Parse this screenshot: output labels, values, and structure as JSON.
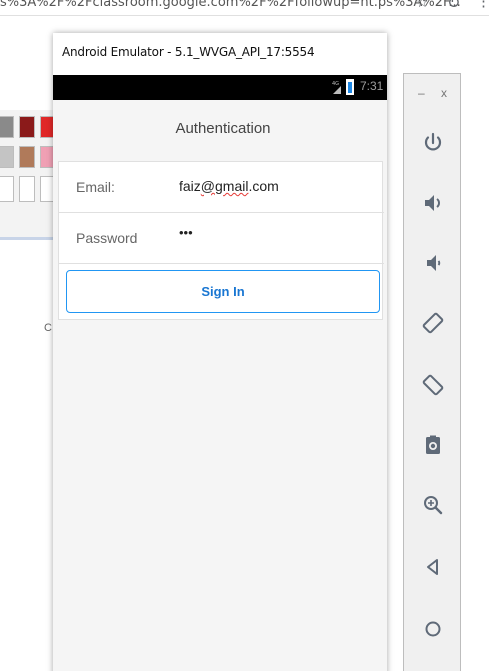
{
  "browser": {
    "url_fragment": "s%3A%2F%2Fclassroom.google.com%2F%2Ffollowup=ht.ps%3A%2F...",
    "star_icon": "star-icon",
    "reload_icon": "reload-icon",
    "more_icon": "more-icon"
  },
  "background_app": {
    "letter": "C",
    "swatches": [
      "#8a8a8a",
      "#8b1a1a",
      "#e02828",
      "#c4c4c4",
      "#b07a5a",
      "#f0a0b4",
      "#ffffff",
      "#ffffff",
      "#ffffff"
    ]
  },
  "emulator": {
    "title": "Android Emulator - 5.1_WVGA_API_17:5554",
    "status_time": "7:31",
    "toolbar": {
      "minimize": "–",
      "close": "x",
      "buttons": [
        "power-icon",
        "volume-up-icon",
        "volume-down-icon",
        "rotate-left-icon",
        "rotate-right-icon",
        "camera-icon",
        "zoom-icon",
        "back-icon",
        "home-icon"
      ]
    }
  },
  "app": {
    "nav_title": "Authentication",
    "email_label": "Email:",
    "email_value_prefix": "faiz",
    "email_value_misspelled": "@gmail",
    "email_value_suffix": ".com",
    "password_label": "Password",
    "password_value": "•••",
    "signin_label": "Sign In"
  },
  "colors": {
    "accent": "#2196f3",
    "status_bar": "#000000",
    "spellcheck": "#e53935"
  }
}
